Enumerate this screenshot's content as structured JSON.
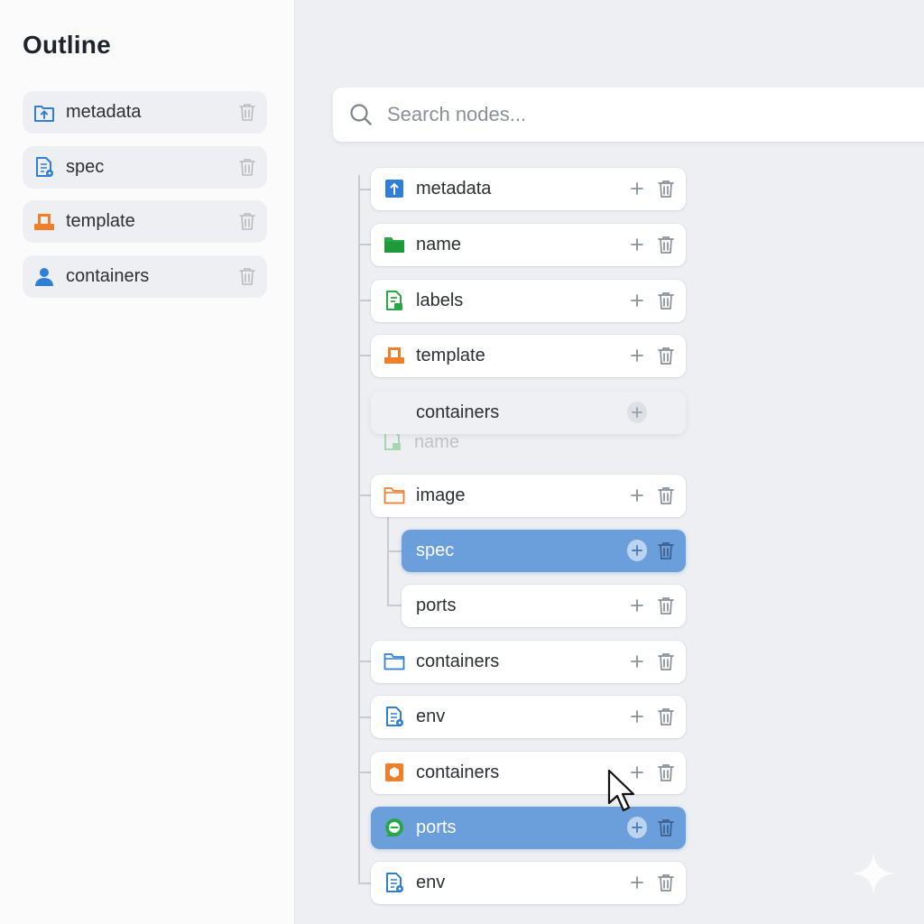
{
  "sidebar": {
    "title": "Outline",
    "items": [
      {
        "label": "metadata",
        "icon": "folder-upload-icon"
      },
      {
        "label": "spec",
        "icon": "document-settings-icon"
      },
      {
        "label": "template",
        "icon": "template-icon"
      },
      {
        "label": "containers",
        "icon": "user-icon"
      }
    ]
  },
  "search": {
    "placeholder": "Search nodes..."
  },
  "tree": {
    "nodes": [
      {
        "label": "metadata",
        "icon": "upload-box-icon",
        "state": "normal"
      },
      {
        "label": "name",
        "icon": "folder-icon",
        "state": "normal"
      },
      {
        "label": "labels",
        "icon": "document-icon",
        "state": "normal"
      },
      {
        "label": "template",
        "icon": "template-icon",
        "state": "normal"
      },
      {
        "label": "containers",
        "icon": "none",
        "state": "dragging"
      },
      {
        "label": "image",
        "icon": "folder-outline-icon",
        "state": "normal"
      },
      {
        "label": "spec",
        "icon": "none",
        "state": "selected"
      },
      {
        "label": "ports",
        "icon": "none",
        "state": "normal"
      },
      {
        "label": "containers",
        "icon": "folder-outline-icon",
        "state": "normal"
      },
      {
        "label": "env",
        "icon": "document-settings-icon",
        "state": "normal"
      },
      {
        "label": "containers",
        "icon": "hexagon-icon",
        "state": "normal"
      },
      {
        "label": "ports",
        "icon": "chat-icon",
        "state": "selected"
      },
      {
        "label": "env",
        "icon": "document-settings-icon",
        "state": "normal"
      }
    ],
    "drag_ghost_label": "name"
  },
  "colors": {
    "accent_blue": "#6b9fdc",
    "icon_blue": "#2f7fd8",
    "icon_green": "#27a844",
    "icon_orange": "#f07f2a"
  }
}
